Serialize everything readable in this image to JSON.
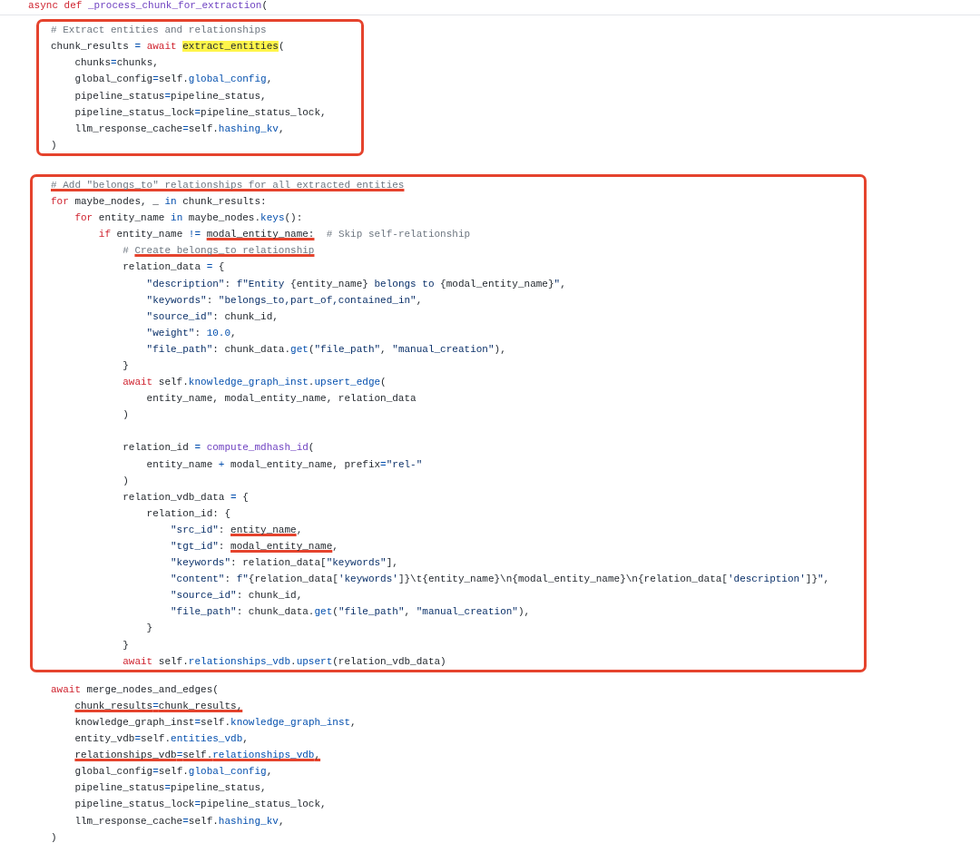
{
  "signature": [
    {
      "text": "async def ",
      "kind": "kw"
    },
    {
      "text": "_process_chunk_for_extraction",
      "kind": "def"
    },
    {
      "text": "("
    }
  ],
  "blocks": [
    {
      "boxed": true,
      "lines": [
        {
          "tokens": [
            {
              "text": "# Extract entities and relationships",
              "kind": "com"
            }
          ]
        },
        {
          "tokens": [
            {
              "text": "chunk_results "
            },
            {
              "text": "=",
              "kind": "op"
            },
            {
              "text": " await ",
              "kind": "kw"
            },
            {
              "text": "extract_entities",
              "highlighted": true
            },
            {
              "text": "("
            }
          ]
        },
        {
          "tokens": [
            {
              "text": "    chunks"
            },
            {
              "text": "=",
              "kind": "op"
            },
            {
              "text": "chunks,"
            }
          ]
        },
        {
          "tokens": [
            {
              "text": "    global_config"
            },
            {
              "text": "=",
              "kind": "op"
            },
            {
              "text": "self."
            },
            {
              "text": "global_config",
              "kind": "attr"
            },
            {
              "text": ","
            }
          ]
        },
        {
          "tokens": [
            {
              "text": "    pipeline_status"
            },
            {
              "text": "=",
              "kind": "op"
            },
            {
              "text": "pipeline_status,"
            }
          ]
        },
        {
          "tokens": [
            {
              "text": "    pipeline_status_lock"
            },
            {
              "text": "=",
              "kind": "op"
            },
            {
              "text": "pipeline_status_lock,"
            }
          ]
        },
        {
          "tokens": [
            {
              "text": "    llm_response_cache"
            },
            {
              "text": "=",
              "kind": "op"
            },
            {
              "text": "self."
            },
            {
              "text": "hashing_kv",
              "kind": "attr"
            },
            {
              "text": ","
            }
          ]
        },
        {
          "tokens": [
            {
              "text": ")"
            }
          ]
        }
      ]
    },
    {
      "boxed": true,
      "lines": [
        {
          "tokens": [
            {
              "text": "# Add \"belongs_to\" relationships for all extracted entities",
              "kind": "com",
              "underlined": true
            }
          ]
        },
        {
          "tokens": [
            {
              "text": "for",
              "kind": "kw"
            },
            {
              "text": " maybe_nodes, _ "
            },
            {
              "text": "in",
              "kind": "op"
            },
            {
              "text": " chunk_results:"
            }
          ]
        },
        {
          "tokens": [
            {
              "text": "    for",
              "kind": "kw"
            },
            {
              "text": " entity_name "
            },
            {
              "text": "in",
              "kind": "op"
            },
            {
              "text": " maybe_nodes."
            },
            {
              "text": "keys",
              "kind": "attr"
            },
            {
              "text": "():"
            }
          ]
        },
        {
          "tokens": [
            {
              "text": "        if",
              "kind": "kw"
            },
            {
              "text": " entity_name "
            },
            {
              "text": "!= ",
              "kind": "op"
            },
            {
              "text": "modal_entity_name:",
              "underlined": true
            },
            {
              "text": "  # Skip self-relationship",
              "kind": "com"
            }
          ]
        },
        {
          "tokens": [
            {
              "text": "            # ",
              "kind": "com"
            },
            {
              "text": "Create belongs_to relationship",
              "kind": "com",
              "underlined": true
            }
          ]
        },
        {
          "tokens": [
            {
              "text": "            relation_data "
            },
            {
              "text": "=",
              "kind": "op"
            },
            {
              "text": " {"
            }
          ]
        },
        {
          "tokens": [
            {
              "text": "                \"description\"",
              "kind": "str"
            },
            {
              "text": ": "
            },
            {
              "text": "f\"Entity ",
              "kind": "str"
            },
            {
              "text": "{entity_name}"
            },
            {
              "text": " belongs to ",
              "kind": "str"
            },
            {
              "text": "{modal_entity_name}"
            },
            {
              "text": "\"",
              "kind": "str"
            },
            {
              "text": ","
            }
          ]
        },
        {
          "tokens": [
            {
              "text": "                \"keywords\"",
              "kind": "str"
            },
            {
              "text": ": "
            },
            {
              "text": "\"belongs_to,part_of,contained_in\"",
              "kind": "str"
            },
            {
              "text": ","
            }
          ]
        },
        {
          "tokens": [
            {
              "text": "                \"source_id\"",
              "kind": "str"
            },
            {
              "text": ": chunk_id,"
            }
          ]
        },
        {
          "tokens": [
            {
              "text": "                \"weight\"",
              "kind": "str"
            },
            {
              "text": ": "
            },
            {
              "text": "10.0",
              "kind": "num"
            },
            {
              "text": ","
            }
          ]
        },
        {
          "tokens": [
            {
              "text": "                \"file_path\"",
              "kind": "str"
            },
            {
              "text": ": chunk_data."
            },
            {
              "text": "get",
              "kind": "attr"
            },
            {
              "text": "("
            },
            {
              "text": "\"file_path\"",
              "kind": "str"
            },
            {
              "text": ", "
            },
            {
              "text": "\"manual_creation\"",
              "kind": "str"
            },
            {
              "text": "),"
            }
          ]
        },
        {
          "tokens": [
            {
              "text": "            }"
            }
          ]
        },
        {
          "tokens": [
            {
              "text": "            await",
              "kind": "kw"
            },
            {
              "text": " self."
            },
            {
              "text": "knowledge_graph_inst",
              "kind": "attr"
            },
            {
              "text": "."
            },
            {
              "text": "upsert_edge",
              "kind": "attr"
            },
            {
              "text": "("
            }
          ]
        },
        {
          "tokens": [
            {
              "text": "                entity_name, modal_entity_name, relation_data"
            }
          ]
        },
        {
          "tokens": [
            {
              "text": "            )"
            }
          ]
        },
        {
          "gap_before": true,
          "tokens": [
            {
              "text": "            relation_id "
            },
            {
              "text": "= ",
              "kind": "op"
            },
            {
              "text": "compute_mdhash_id",
              "kind": "def"
            },
            {
              "text": "("
            }
          ]
        },
        {
          "tokens": [
            {
              "text": "                entity_name "
            },
            {
              "text": "+",
              "kind": "op"
            },
            {
              "text": " modal_entity_name, prefix"
            },
            {
              "text": "=",
              "kind": "op"
            },
            {
              "text": "\"rel-\"",
              "kind": "str"
            }
          ]
        },
        {
          "tokens": [
            {
              "text": "            )"
            }
          ]
        },
        {
          "tokens": [
            {
              "text": "            relation_vdb_data "
            },
            {
              "text": "=",
              "kind": "op"
            },
            {
              "text": " {"
            }
          ]
        },
        {
          "tokens": [
            {
              "text": "                relation_id: {"
            }
          ]
        },
        {
          "tokens": [
            {
              "text": "                    \"src_id\"",
              "kind": "str"
            },
            {
              "text": ": "
            },
            {
              "text": "entity_name",
              "underlined": true
            },
            {
              "text": ","
            }
          ]
        },
        {
          "tokens": [
            {
              "text": "                    \"tgt_id\"",
              "kind": "str"
            },
            {
              "text": ": "
            },
            {
              "text": "modal_entity_name",
              "underlined": true
            },
            {
              "text": ","
            }
          ]
        },
        {
          "tokens": [
            {
              "text": "                    \"keywords\"",
              "kind": "str"
            },
            {
              "text": ": relation_data["
            },
            {
              "text": "\"keywords\"",
              "kind": "str"
            },
            {
              "text": "],"
            }
          ]
        },
        {
          "tokens": [
            {
              "text": "                    \"content\"",
              "kind": "str"
            },
            {
              "text": ": "
            },
            {
              "text": "f\"",
              "kind": "str"
            },
            {
              "text": "{relation_data["
            },
            {
              "text": "'keywords'",
              "kind": "str"
            },
            {
              "text": "]}\\t{entity_name}\\n{modal_entity_name}\\n{relation_data["
            },
            {
              "text": "'description'",
              "kind": "str"
            },
            {
              "text": "]}"
            },
            {
              "text": "\"",
              "kind": "str"
            },
            {
              "text": ","
            }
          ]
        },
        {
          "tokens": [
            {
              "text": "                    \"source_id\"",
              "kind": "str"
            },
            {
              "text": ": chunk_id,"
            }
          ]
        },
        {
          "tokens": [
            {
              "text": "                    \"file_path\"",
              "kind": "str"
            },
            {
              "text": ": chunk_data."
            },
            {
              "text": "get",
              "kind": "attr"
            },
            {
              "text": "("
            },
            {
              "text": "\"file_path\"",
              "kind": "str"
            },
            {
              "text": ", "
            },
            {
              "text": "\"manual_creation\"",
              "kind": "str"
            },
            {
              "text": "),"
            }
          ]
        },
        {
          "tokens": [
            {
              "text": "                }"
            }
          ]
        },
        {
          "tokens": [
            {
              "text": "            }"
            }
          ]
        },
        {
          "tokens": [
            {
              "text": "            await",
              "kind": "kw"
            },
            {
              "text": " self."
            },
            {
              "text": "relationships_vdb",
              "kind": "attr"
            },
            {
              "text": "."
            },
            {
              "text": "upsert",
              "kind": "attr"
            },
            {
              "text": "(relation_vdb_data)"
            }
          ]
        }
      ]
    },
    {
      "lines": [
        {
          "tokens": [
            {
              "text": "await",
              "kind": "kw"
            },
            {
              "text": " merge_nodes_and_edges("
            }
          ]
        },
        {
          "tokens": [
            {
              "text": "    chunk_results",
              "underlined": true
            },
            {
              "text": "=",
              "kind": "op",
              "underlined": true
            },
            {
              "text": "chunk_results,",
              "underlined": true
            }
          ]
        },
        {
          "tokens": [
            {
              "text": "    knowledge_graph_inst"
            },
            {
              "text": "=",
              "kind": "op"
            },
            {
              "text": "self."
            },
            {
              "text": "knowledge_graph_inst",
              "kind": "attr"
            },
            {
              "text": ","
            }
          ]
        },
        {
          "tokens": [
            {
              "text": "    entity_vdb"
            },
            {
              "text": "=",
              "kind": "op"
            },
            {
              "text": "self."
            },
            {
              "text": "entities_vdb",
              "kind": "attr"
            },
            {
              "text": ","
            }
          ]
        },
        {
          "tokens": [
            {
              "text": "    relationships_vdb",
              "underlined": true
            },
            {
              "text": "=",
              "kind": "op",
              "underlined": true
            },
            {
              "text": "self.",
              "underlined": true
            },
            {
              "text": "relationships_vdb",
              "kind": "attr",
              "underlined": true
            },
            {
              "text": ",",
              "underlined": true
            }
          ]
        },
        {
          "tokens": [
            {
              "text": "    global_config"
            },
            {
              "text": "=",
              "kind": "op"
            },
            {
              "text": "self."
            },
            {
              "text": "global_config",
              "kind": "attr"
            },
            {
              "text": ","
            }
          ]
        },
        {
          "tokens": [
            {
              "text": "    pipeline_status"
            },
            {
              "text": "=",
              "kind": "op"
            },
            {
              "text": "pipeline_status,"
            }
          ]
        },
        {
          "tokens": [
            {
              "text": "    pipeline_status_lock"
            },
            {
              "text": "=",
              "kind": "op"
            },
            {
              "text": "pipeline_status_lock,"
            }
          ]
        },
        {
          "tokens": [
            {
              "text": "    llm_response_cache"
            },
            {
              "text": "=",
              "kind": "op"
            },
            {
              "text": "self."
            },
            {
              "text": "hashing_kv",
              "kind": "attr"
            },
            {
              "text": ","
            }
          ]
        },
        {
          "tokens": [
            {
              "text": ")"
            }
          ]
        }
      ]
    }
  ]
}
